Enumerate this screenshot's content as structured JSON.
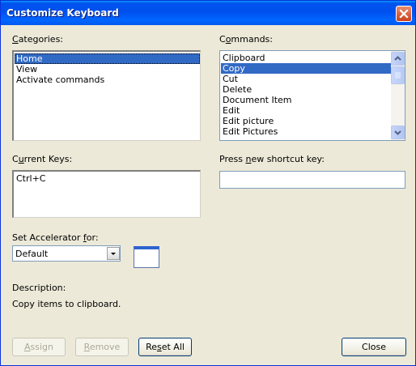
{
  "window": {
    "title": "Customize Keyboard",
    "close_icon": "close-x-icon"
  },
  "categories": {
    "label_pre": "",
    "label_access": "C",
    "label_post": "ategories:",
    "items": [
      "Home",
      "View",
      "Activate commands"
    ],
    "selected": "Home"
  },
  "commands": {
    "label_pre": "C",
    "label_access": "o",
    "label_post": "mmands:",
    "items": [
      "Clipboard",
      "Copy",
      "Cut",
      "Delete",
      "Document Item",
      "Edit",
      "Edit picture",
      "Edit Pictures"
    ],
    "selected": "Copy"
  },
  "current_keys": {
    "label_pre": "C",
    "label_access": "u",
    "label_post": "rrent Keys:",
    "items": [
      "Ctrl+C"
    ]
  },
  "new_shortcut": {
    "label_pre": "Press ",
    "label_access": "n",
    "label_post": "ew shortcut key:",
    "value": ""
  },
  "accelerator": {
    "label_pre": "Set Accelerator ",
    "label_access": "f",
    "label_post": "or:",
    "selected": "Default"
  },
  "description": {
    "label": "Description:",
    "text": "Copy items to clipboard."
  },
  "buttons": {
    "assign": {
      "pre": "",
      "access": "A",
      "post": "ssign"
    },
    "remove": {
      "pre": "",
      "access": "R",
      "post": "emove"
    },
    "reset_all": {
      "pre": "Re",
      "access": "s",
      "post": "et All"
    },
    "close": {
      "pre": "Close",
      "access": "",
      "post": ""
    }
  },
  "colors": {
    "title_bar": "#0054e3",
    "selection": "#316ac5",
    "dialog_bg": "#ece9d8",
    "close_button": "#d44a23"
  }
}
